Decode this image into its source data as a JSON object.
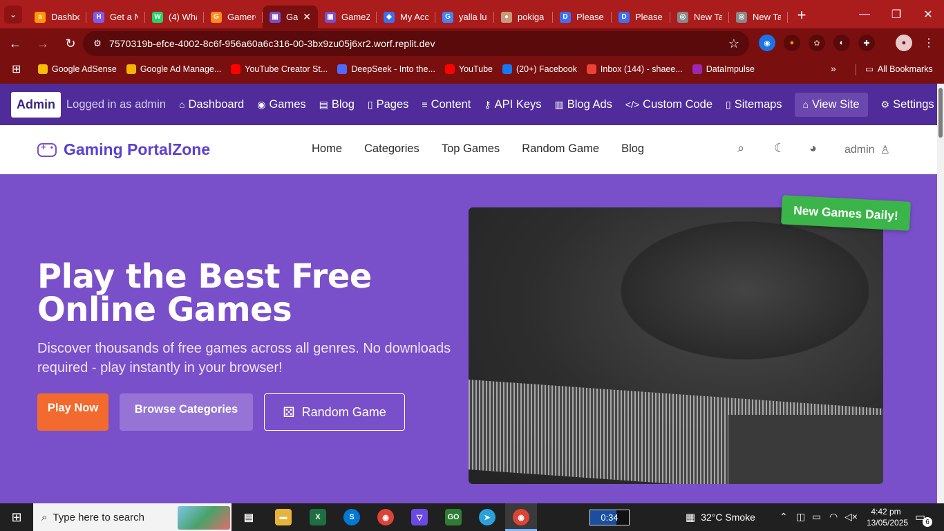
{
  "browser": {
    "tabs": [
      {
        "label": "Dashbo",
        "fav_char": "a",
        "fav_color": "#ff9900"
      },
      {
        "label": "Get a N",
        "fav_char": "H",
        "fav_color": "#7b5cf0"
      },
      {
        "label": "(4) Wha",
        "fav_char": "W",
        "fav_color": "#25d366"
      },
      {
        "label": "GamerC",
        "fav_char": "G",
        "fav_color": "#ff8a1a"
      },
      {
        "label": "Ga",
        "fav_char": "▣",
        "fav_color": "#7a4fca",
        "close": "✕"
      },
      {
        "label": "GameZ",
        "fav_char": "▣",
        "fav_color": "#7a4fca"
      },
      {
        "label": "My Acc",
        "fav_char": "◆",
        "fav_color": "#3b6ff5"
      },
      {
        "label": "yalla lu",
        "fav_char": "G",
        "fav_color": "#4285f4"
      },
      {
        "label": "pokiga",
        "fav_char": "●",
        "fav_color": "#c79a7a"
      },
      {
        "label": "Please",
        "fav_char": "D",
        "fav_color": "#3b6ff5"
      },
      {
        "label": "Please",
        "fav_char": "D",
        "fav_color": "#3b6ff5"
      },
      {
        "label": "New Ta",
        "fav_char": "◎",
        "fav_color": "#888888"
      },
      {
        "label": "New Ta",
        "fav_char": "◎",
        "fav_color": "#888888"
      }
    ],
    "new_tab": "+",
    "window_controls": {
      "minimize": "—",
      "restore": "❐",
      "close": "✕"
    },
    "url": "7570319b-efce-4002-8c6f-956a60a6c316-00-3bx9zu05j6xr2.worf.replit.dev",
    "bookmarks": [
      {
        "label": "Google AdSense",
        "fav_color": "#fbbc04"
      },
      {
        "label": "Google Ad Manage...",
        "fav_color": "#f4b400"
      },
      {
        "label": "YouTube Creator St...",
        "fav_color": "#ff0000"
      },
      {
        "label": "DeepSeek - Into the...",
        "fav_color": "#4d6bfe"
      },
      {
        "label": "YouTube",
        "fav_color": "#ff0000"
      },
      {
        "label": "(20+) Facebook",
        "fav_color": "#1877f2"
      },
      {
        "label": "Inbox (144) - shaee...",
        "fav_color": "#ea4335"
      },
      {
        "label": "DataImpulse",
        "fav_color": "#9c27b0"
      }
    ],
    "bookmarks_more": "»",
    "all_bookmarks": "All Bookmarks"
  },
  "admin_bar": {
    "badge": "Admin",
    "logged_in": "Logged in as admin",
    "items": [
      {
        "label": "Dashboard",
        "icon": "⌂"
      },
      {
        "label": "Games",
        "icon": "◉"
      },
      {
        "label": "Blog",
        "icon": "▤"
      },
      {
        "label": "Pages",
        "icon": "▯"
      },
      {
        "label": "Content",
        "icon": "≡"
      },
      {
        "label": "API Keys",
        "icon": "⚷"
      },
      {
        "label": "Blog Ads",
        "icon": "▥"
      },
      {
        "label": "Custom Code",
        "icon": "</>"
      },
      {
        "label": "Sitemaps",
        "icon": "▯"
      }
    ],
    "view_site": "View Site",
    "settings": "Settings"
  },
  "site_header": {
    "logo": "Gaming PortalZone",
    "nav": [
      "Home",
      "Categories",
      "Top Games",
      "Random Game",
      "Blog"
    ],
    "user": "admin"
  },
  "hero": {
    "title": "Play the Best Free Online Games",
    "subtitle": "Discover thousands of free games across all genres. No downloads required - play instantly in your browser!",
    "btn_play": "Play Now",
    "btn_browse": "Browse Categories",
    "btn_random": "Random Game",
    "ribbon": "New Games Daily!"
  },
  "taskbar": {
    "search_placeholder": "Type here to search",
    "timer": "0:34",
    "weather": "32°C  Smoke",
    "time": "4:42 pm",
    "date": "13/05/2025",
    "notifications": "6"
  }
}
